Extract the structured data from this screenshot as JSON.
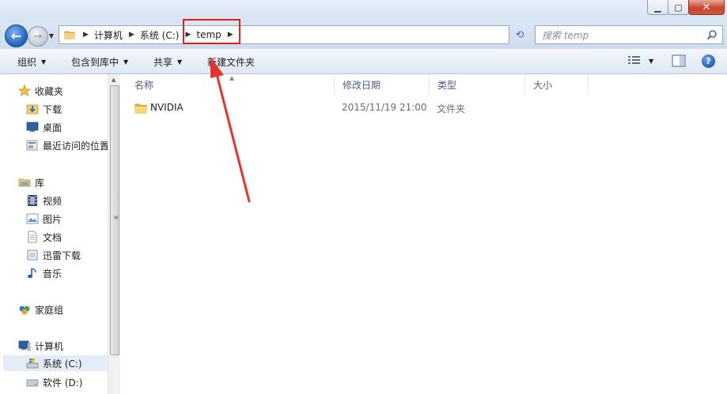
{
  "window": {
    "minimize_glyph": "▁",
    "maximize_glyph": "▢",
    "close_glyph": "✕"
  },
  "nav": {
    "back_glyph": "←",
    "forward_glyph": "→",
    "dropdown_glyph": "▼"
  },
  "address": {
    "crumbs": [
      "计算机",
      "系统 (C:)",
      "temp"
    ],
    "separator": "▶",
    "dropdown_glyph": "▼",
    "refresh_glyph": "⟲"
  },
  "search": {
    "placeholder": "搜索 temp"
  },
  "toolbar": {
    "organize": "组织",
    "include_in_library": "包含到库中",
    "share": "共享",
    "new_folder": "新建文件夹",
    "arrow": "▼",
    "view_arrow": "▼",
    "help_glyph": "?"
  },
  "sidebar": {
    "favorites": "收藏夹",
    "favorites_items": [
      "下载",
      "桌面",
      "最近访问的位置"
    ],
    "libraries": "库",
    "library_items": [
      "视频",
      "图片",
      "文档",
      "迅雷下载",
      "音乐"
    ],
    "homegroup": "家庭组",
    "computer": "计算机",
    "computer_items": [
      "系统 (C:)",
      "软件 (D:)"
    ],
    "selected": "系统 (C:)"
  },
  "columns": {
    "name": "名称",
    "date_modified": "修改日期",
    "type": "类型",
    "size": "大小"
  },
  "files": [
    {
      "name": "NVIDIA",
      "date_modified": "2015/11/19 21:00",
      "type": "文件夹",
      "size": ""
    }
  ],
  "colors": {
    "highlight_box": "#e0201c",
    "annotation_arrow": "#e8322c",
    "selected_nav": "#e4ecf7"
  }
}
